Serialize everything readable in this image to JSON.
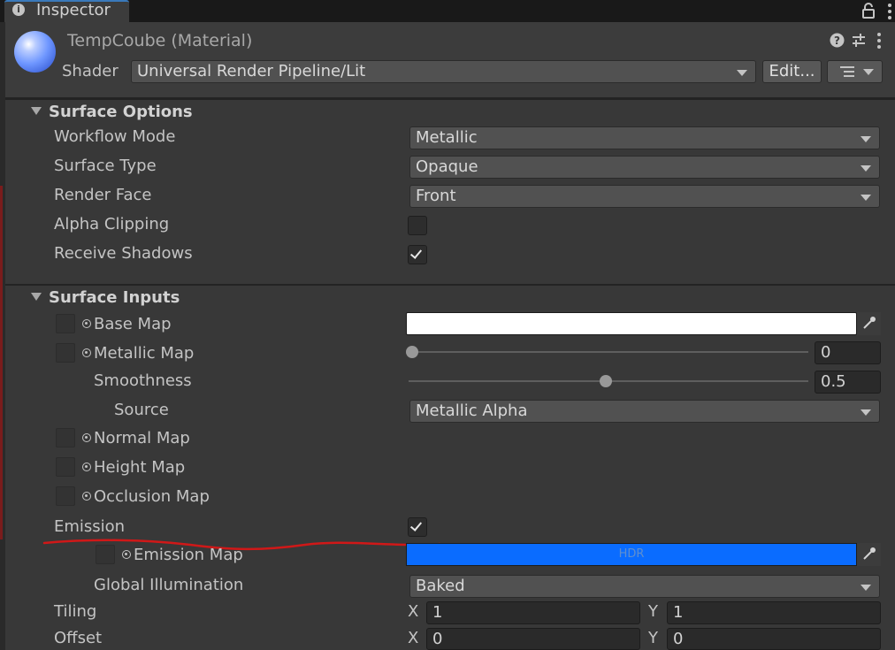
{
  "tab": {
    "label": "Inspector"
  },
  "material": {
    "name": "TempCoube (Material)"
  },
  "shader": {
    "label": "Shader",
    "value": "Universal Render Pipeline/Lit",
    "edit_label": "Edit..."
  },
  "surface_options": {
    "title": "Surface Options",
    "workflow_mode": {
      "label": "Workflow Mode",
      "value": "Metallic"
    },
    "surface_type": {
      "label": "Surface Type",
      "value": "Opaque"
    },
    "render_face": {
      "label": "Render Face",
      "value": "Front"
    },
    "alpha_clipping": {
      "label": "Alpha Clipping",
      "checked": false
    },
    "receive_shadows": {
      "label": "Receive Shadows",
      "checked": true
    }
  },
  "surface_inputs": {
    "title": "Surface Inputs",
    "base_map": {
      "label": "Base Map",
      "color": "#ffffff"
    },
    "metallic_map": {
      "label": "Metallic Map",
      "value": "0",
      "fraction": 0
    },
    "smoothness": {
      "label": "Smoothness",
      "value": "0.5",
      "fraction": 0.5
    },
    "source": {
      "label": "Source",
      "value": "Metallic Alpha"
    },
    "normal_map": {
      "label": "Normal Map"
    },
    "height_map": {
      "label": "Height Map"
    },
    "occlusion_map": {
      "label": "Occlusion Map"
    },
    "emission": {
      "label": "Emission",
      "checked": true
    },
    "emission_map": {
      "label": "Emission Map",
      "color": "#0a6cff",
      "hdr_label": "HDR"
    },
    "global_illumination": {
      "label": "Global Illumination",
      "value": "Baked"
    },
    "tiling": {
      "label": "Tiling",
      "x_label": "X",
      "y_label": "Y",
      "x": "1",
      "y": "1"
    },
    "offset": {
      "label": "Offset",
      "x_label": "X",
      "y_label": "Y",
      "x": "0",
      "y": "0"
    }
  },
  "annotation": {
    "color": "#d01818"
  }
}
